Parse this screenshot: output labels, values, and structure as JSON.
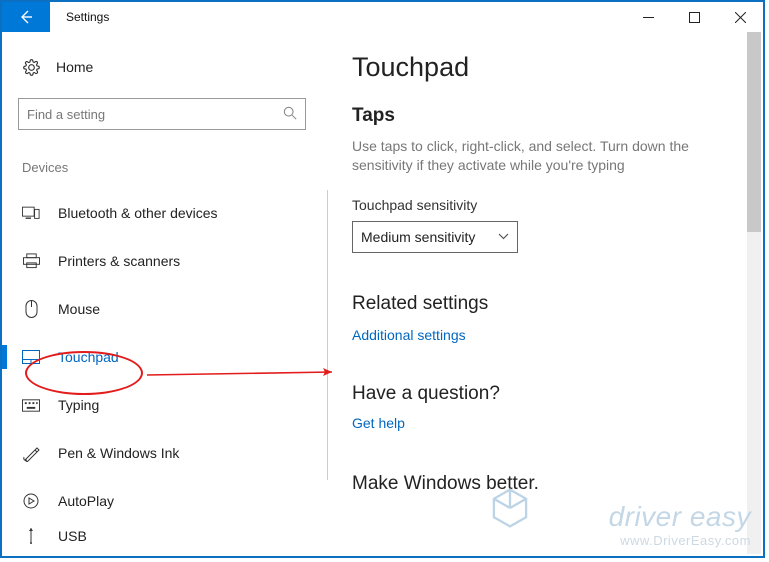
{
  "titlebar": {
    "app_name": "Settings"
  },
  "sidebar": {
    "home_label": "Home",
    "search_placeholder": "Find a setting",
    "group_label": "Devices",
    "items": [
      {
        "label": "Bluetooth & other devices",
        "icon": "bt"
      },
      {
        "label": "Printers & scanners",
        "icon": "printer"
      },
      {
        "label": "Mouse",
        "icon": "mouse"
      },
      {
        "label": "Touchpad",
        "icon": "touchpad",
        "active": true
      },
      {
        "label": "Typing",
        "icon": "keyboard"
      },
      {
        "label": "Pen & Windows Ink",
        "icon": "pen"
      },
      {
        "label": "AutoPlay",
        "icon": "autoplay"
      },
      {
        "label": "USB",
        "icon": "usb"
      }
    ]
  },
  "main": {
    "title": "Touchpad",
    "taps_header": "Taps",
    "taps_desc": "Use taps to click, right-click, and select. Turn down the sensitivity if they activate while you're typing",
    "sensitivity_label": "Touchpad sensitivity",
    "sensitivity_value": "Medium sensitivity",
    "related_header": "Related settings",
    "related_link": "Additional settings",
    "question_header": "Have a question?",
    "help_link": "Get help",
    "better_header": "Make Windows better."
  },
  "watermark": {
    "brand": "driver easy",
    "url": "www.DriverEasy.com"
  }
}
